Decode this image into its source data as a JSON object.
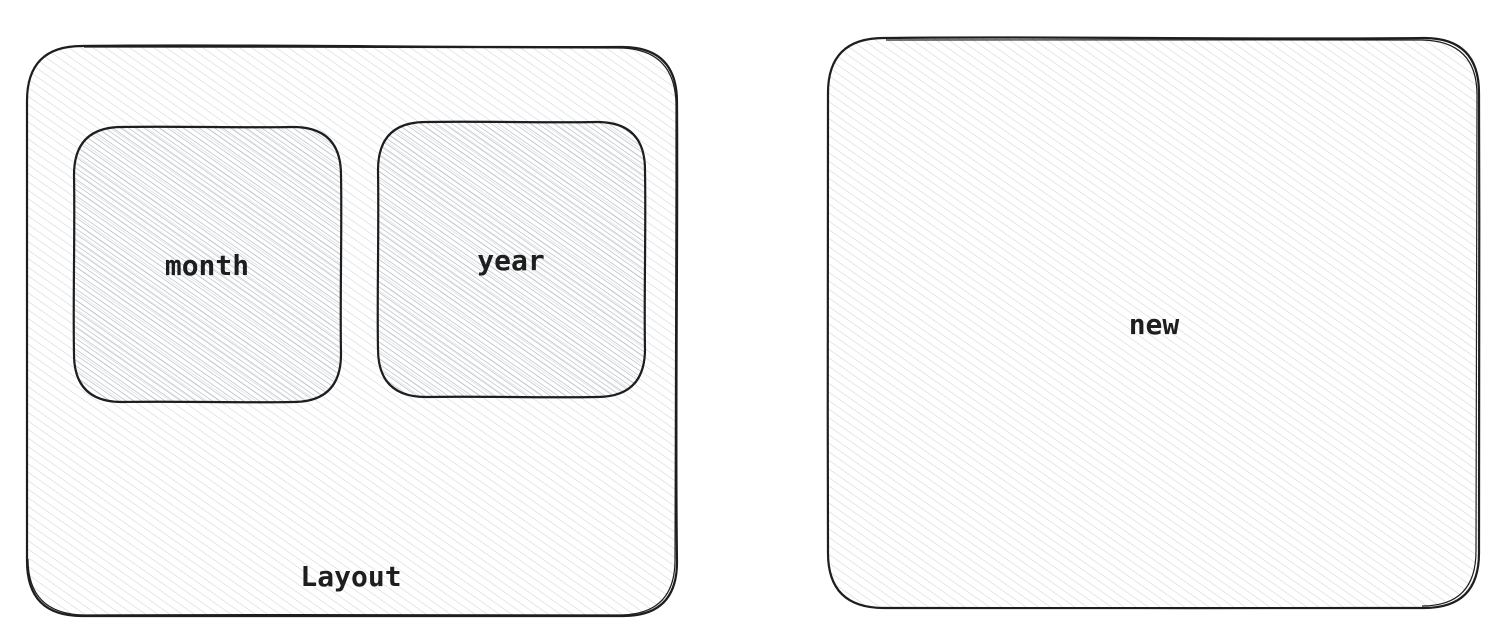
{
  "diagram": {
    "layout_box": {
      "label": "Layout",
      "fill_color": "#ced4da",
      "stroke_color": "#1e1e1e"
    },
    "month_box": {
      "label": "month",
      "fill_color": "#adb5bd",
      "stroke_color": "#1e1e1e"
    },
    "year_box": {
      "label": "year",
      "fill_color": "#adb5bd",
      "stroke_color": "#1e1e1e"
    },
    "new_box": {
      "label": "new",
      "fill_color": "#ced4da",
      "stroke_color": "#1e1e1e"
    }
  }
}
